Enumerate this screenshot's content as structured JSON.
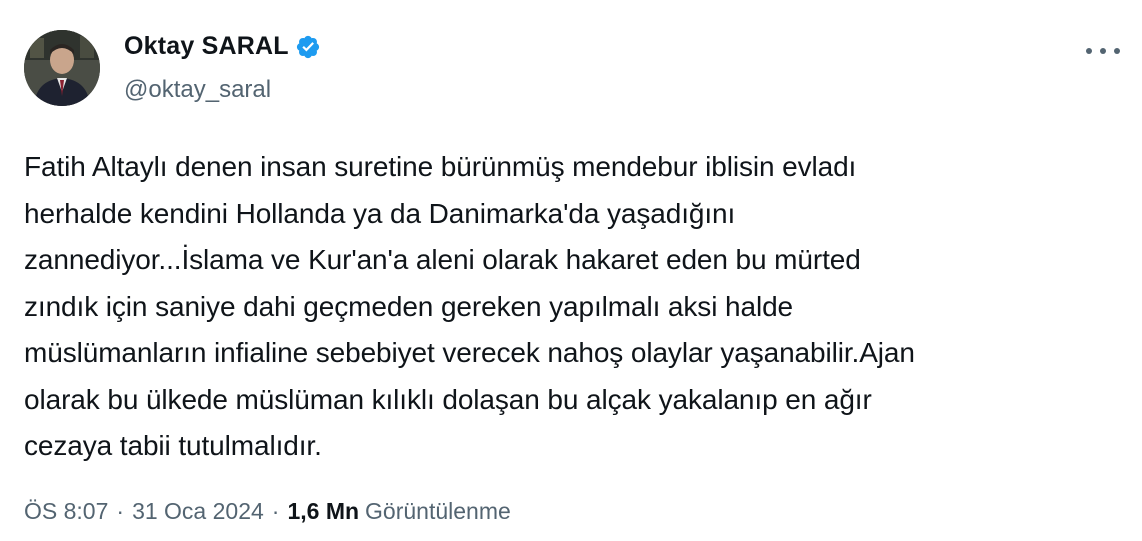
{
  "author": {
    "name": "Oktay SARAL",
    "handle": "@oktay_saral",
    "verified_color": "#1d9bf0"
  },
  "tweet": {
    "text": "Fatih Altaylı denen insan suretine bürünmüş mendebur iblisin evladı\nherhalde kendini Hollanda ya da Danimarka'da yaşadığını\nzannediyor...İslama ve Kur'an'a aleni olarak hakaret eden bu mürted\nzındık için saniye dahi geçmeden gereken yapılmalı aksi halde\nmüslümanların infialine sebebiyet verecek nahoş olaylar yaşanabilir.Ajan\nolarak bu ülkede müslüman kılıklı dolaşan bu alçak yakalanıp en ağır\ncezaya tabii tutulmalıdır."
  },
  "meta": {
    "time": "ÖS 8:07",
    "separator": "·",
    "date": "31 Oca 2024",
    "views_count": "1,6 Mn",
    "views_label": "Görüntülenme"
  },
  "icons": {
    "verified": "verified-badge-icon",
    "more": "more-options-icon"
  }
}
